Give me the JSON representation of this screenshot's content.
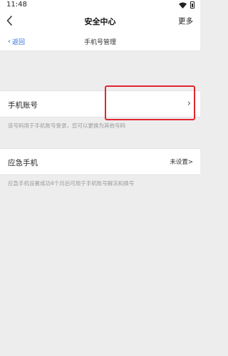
{
  "status_bar": {
    "time": "11:48",
    "icons": [
      "wifi-icon",
      "battery-icon"
    ]
  },
  "app_bar": {
    "back_icon": "back-arrow-icon",
    "title": "安全中心",
    "more_label": "更多"
  },
  "sub_header": {
    "back_label": "返回",
    "title": "手机号管理"
  },
  "phone_account": {
    "label": "手机账号",
    "hint": "该号码用于手机账号登录，您可以更换为其他号码"
  },
  "emergency_phone": {
    "label": "应急手机",
    "value": "未设置>",
    "hint": "应急手机设置成功4个月后可用于手机账号解冻和换号"
  },
  "colors": {
    "accent_link": "#2f6bd8",
    "highlight_border": "#e0272e",
    "page_background": "#ededee"
  }
}
